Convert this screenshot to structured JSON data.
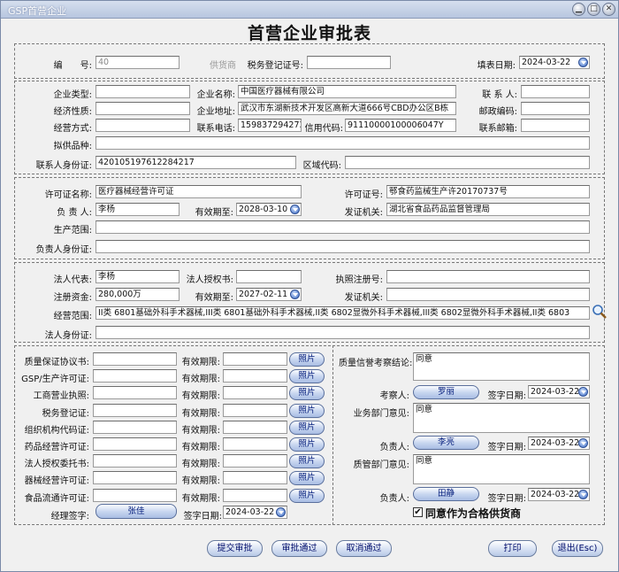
{
  "window": {
    "title": "GSP首营企业"
  },
  "heading": "首营企业审批表",
  "top": {
    "bianhao_label": "编　　号:",
    "bianhao_value": "40",
    "gys_label": "供货商",
    "swdj_label": "税务登记证号:",
    "swdj_value": "",
    "tbrq_label": "填表日期:",
    "tbrq_value": "2024-03-22"
  },
  "company": {
    "qylx_label": "企业类型:",
    "qylx": "",
    "qymc_label": "企业名称:",
    "qymc": "中国医疗器械有限公司",
    "lxr_label": "联 系 人:",
    "lxr": "",
    "jjxz_label": "经济性质:",
    "jjxz": "",
    "qydz_label": "企业地址:",
    "qydz": "武汉市东湖新技术开发区高新大道666号CBD办公区B栋",
    "yzbm_label": "邮政编码:",
    "yzbm": "",
    "jyfs_label": "经营方式:",
    "jyfs": "",
    "lxdh_label": "联系电话:",
    "lxdh": "15983729427З",
    "xydm_label": "信用代码:",
    "xydm": "91110000100006047Y",
    "lxyx_label": "联系邮箱:",
    "lxyx": "",
    "ngpz_label": "拟供品种:",
    "ngpz": "",
    "lxrsfz_label": "联系人身份证:",
    "lxrsfz": "420105197612284217",
    "qydm_label": "区域代码:",
    "qydm": ""
  },
  "license": {
    "xkzmc_label": "许可证名称:",
    "xkzmc": "医疗器械经营许可证",
    "xkzh_label": "许可证号:",
    "xkzh": "鄂食药监械生产许20170737号",
    "fzr_label": "负 责 人:",
    "fzr": "李杨",
    "yxqz_label": "有效期至:",
    "yxqz": "2028-03-10",
    "fzjg_label": "发证机关:",
    "fzjg": "湖北省食品药品监督管理局",
    "scfw_label": "生产范围:",
    "scfw": "",
    "fzrsfz_label": "负责人身份证:",
    "fzrsfz": ""
  },
  "legal": {
    "frdb_label": "法人代表:",
    "frdb": "李杨",
    "frsqs_label": "法人授权书:",
    "frsqs": "",
    "zzzch_label": "执照注册号:",
    "zzzch": "",
    "zczj_label": "注册资金:",
    "zczj": "280,000万",
    "yxqz_label": "有效期至:",
    "yxqz": "2027-02-11",
    "fzjg_label": "发证机关:",
    "fzjg": "",
    "jyfw_label": "经营范围:",
    "jyfw": "II类 6801基础外科手术器械,III类 6801基础外科手术器械,II类 6802显微外科手术器械,III类 6802显微外科手术器械,II类 6803",
    "frsfz_label": "法人身份证:",
    "frsfz": ""
  },
  "docs": {
    "valid_label": "有效期限:",
    "photo_label": "照片",
    "items": [
      {
        "label": "质量保证协议书:",
        "value": "",
        "valid": ""
      },
      {
        "label": "GSP/生产许可证:",
        "value": "",
        "valid": ""
      },
      {
        "label": "工商营业执照:",
        "value": "",
        "valid": ""
      },
      {
        "label": "税务登记证:",
        "value": "",
        "valid": ""
      },
      {
        "label": "组织机构代码证:",
        "value": "",
        "valid": ""
      },
      {
        "label": "药品经营许可证:",
        "value": "",
        "valid": ""
      },
      {
        "label": "法人授权委托书:",
        "value": "",
        "valid": ""
      },
      {
        "label": "器械经营许可证:",
        "value": "",
        "valid": ""
      },
      {
        "label": "食品流通许可证:",
        "value": "",
        "valid": ""
      }
    ],
    "jlqz_label": "经理签字:",
    "jlqz": "张佳",
    "qzrq_label": "签字日期:",
    "qzrq": "2024-03-22"
  },
  "approval": {
    "zlxy_label": "质量信誉考察结论:",
    "zlxy": "同意",
    "kcr_label": "考察人:",
    "kcr": "罗丽",
    "qzrq_label": "签字日期:",
    "kcr_date": "2024-03-22",
    "ywbm_label": "业务部门意见:",
    "ywbm": "同意",
    "fzr_label": "负责人:",
    "fzr1": "李亮",
    "fzr1_date": "2024-03-22",
    "zgbm_label": "质管部门意见:",
    "zgbm": "同意",
    "fzr2": "田静",
    "fzr2_date": "2024-03-22",
    "agree_label": "同意作为合格供货商",
    "agree_checked": "✔"
  },
  "buttons": {
    "submit": "提交审批",
    "pass": "审批通过",
    "cancel": "取消通过",
    "print": "打印",
    "exit": "退出(Esc)"
  }
}
